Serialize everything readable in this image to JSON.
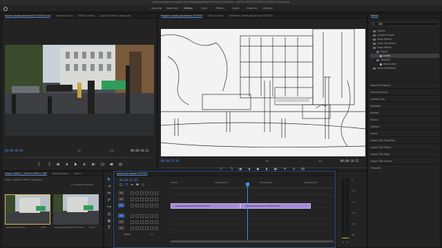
{
  "titlebar": {
    "text": "/Users/meganmurray/Documents/Adobe/Premiere Pro/12.0/Untitled - SKETCH EFFECT/SKETCH_EFFECT_WIP.prproj"
  },
  "workspaces": [
    "Learning",
    "Assembly",
    "Editing",
    "Color",
    "Effects",
    "Audio",
    "Graphics",
    "Libraries"
  ],
  "workspace_active": "Editing",
  "source": {
    "tabs": [
      "Source: pexels-pat-whelan-5737543.mp4",
      "Lumetri Scopes",
      "Effect Controls",
      "Audio Clip Mixer: pexels-pat"
    ],
    "timecode_in": "00:00:00:03",
    "fit": "Fit",
    "fit_ratio": "Full",
    "duration": "00:00:18:11"
  },
  "program": {
    "tabs": [
      "Program: pexels-pat-whelan-5737543",
      "Title: (no title)",
      "Reference: pexels-pat-whelan-5737543"
    ],
    "timecode": "00:00:21:03",
    "fit": "Fit",
    "ratio": "1/2",
    "duration": "00:00:34:22"
  },
  "effects": {
    "title": "Effects",
    "search_value": "LINE",
    "tree": [
      {
        "label": "Presets",
        "level": 0,
        "kind": "folder"
      },
      {
        "label": "Lumetri Presets",
        "level": 0,
        "kind": "folder"
      },
      {
        "label": "Audio Effects",
        "level": 0,
        "kind": "folder"
      },
      {
        "label": "Audio Transitions",
        "level": 0,
        "kind": "folder"
      },
      {
        "label": "Video Effects",
        "level": 0,
        "kind": "folder"
      },
      {
        "label": "Adjust",
        "level": 1,
        "kind": "folder"
      },
      {
        "label": "Levels",
        "level": 2,
        "kind": "fx",
        "selected": true
      },
      {
        "label": "Obsolete",
        "level": 1,
        "kind": "folder"
      },
      {
        "label": "Auto Levels",
        "level": 2,
        "kind": "fx"
      },
      {
        "label": "Video Transitions",
        "level": 0,
        "kind": "folder"
      }
    ],
    "collapsed_panels": [
      "Essential Graphics",
      "Essential Sound",
      "Lumetri Color",
      "Metadata",
      "Markers",
      "History",
      "Captions",
      "Events",
      "Legacy Title Properties",
      "Legacy Title Styles",
      "Legacy Title Tools",
      "Legacy Title Actions",
      "Timecode"
    ]
  },
  "project": {
    "tabs": [
      "Project: DMGC_7_SKETCH EFFECT_WIP",
      "Media Browser",
      "Librari"
    ],
    "path": "DMGC_7_SKETCH EFFECT_WIP.prproj",
    "count": "1 of 2 items selected",
    "items": [
      {
        "name": "pexels-pat-whelan-...",
        "duration": "18:11"
      },
      {
        "name": "pexels-pat-whelan-5737543",
        "duration": "34:22"
      }
    ]
  },
  "timeline": {
    "tab": "pexels-pat-whelan-5737543",
    "timecode": "00:00:21:03",
    "ruler_labels": [
      ":00:00",
      "00:00:14:23",
      "00:00:29:23",
      "00:00:44:22"
    ],
    "video_tracks": [
      "V3",
      "V2",
      "V1"
    ],
    "audio_tracks": [
      "A1",
      "A2",
      "A3"
    ],
    "master_label": "Master",
    "master_value": "0.0",
    "clips": [
      {
        "label": "pexels-pat-whelan-5737543.mp4",
        "start": 0.0,
        "end": 0.43
      },
      {
        "label": "pexels-pat-whelan-5737543.mp4",
        "start": 0.43,
        "end": 0.86
      }
    ],
    "playhead": 0.47
  },
  "meters": {
    "scale": [
      "0",
      "-12",
      "-24",
      "-36",
      "-48",
      "dB"
    ],
    "solo": "S",
    "solo2": "S"
  }
}
